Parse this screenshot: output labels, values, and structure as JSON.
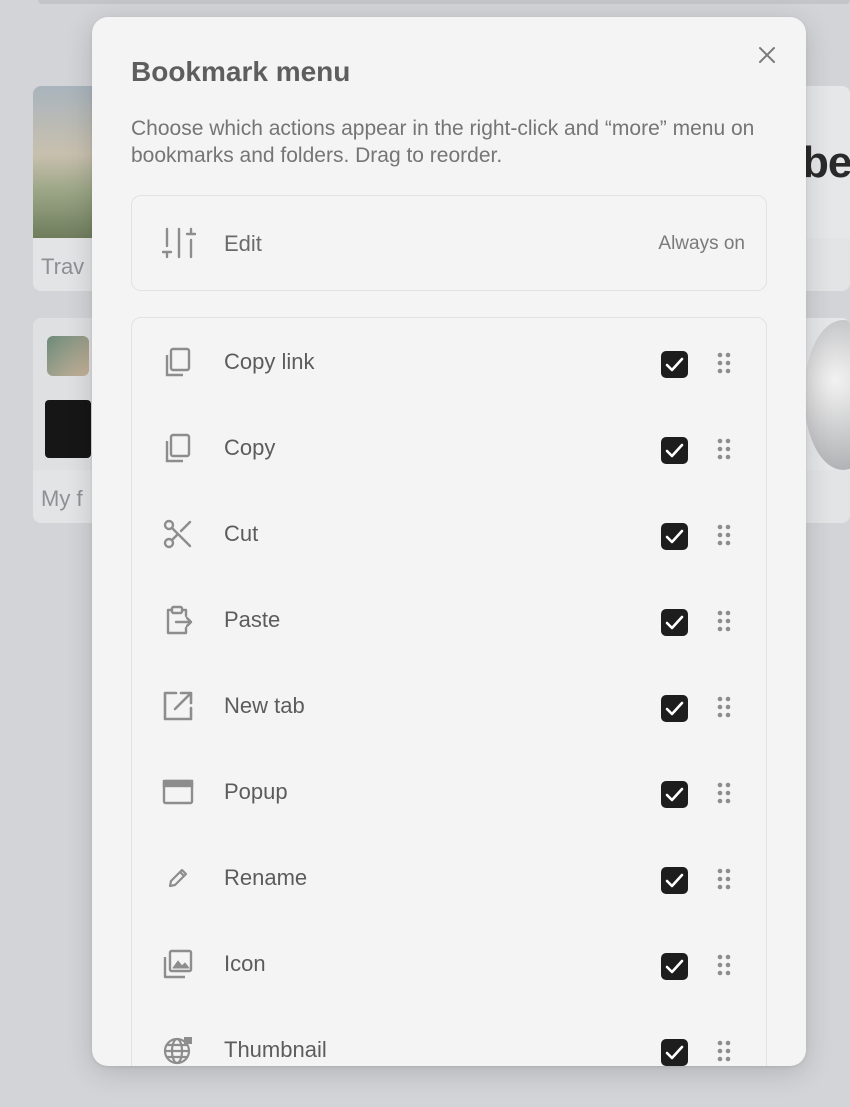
{
  "background": {
    "cards": [
      {
        "label": "Trav"
      },
      {
        "label": "My f"
      },
      {
        "label": "be"
      }
    ]
  },
  "dialog": {
    "title": "Bookmark menu",
    "description": "Choose which actions appear in the right-click and “more” menu on bookmarks and folders. Drag to reorder.",
    "fixed_item": {
      "label": "Edit",
      "state": "Always on"
    },
    "items": [
      {
        "label": "Copy link",
        "icon": "copy-link-icon",
        "checked": true
      },
      {
        "label": "Copy",
        "icon": "copy-icon",
        "checked": true
      },
      {
        "label": "Cut",
        "icon": "scissors-icon",
        "checked": true
      },
      {
        "label": "Paste",
        "icon": "paste-icon",
        "checked": true
      },
      {
        "label": "New tab",
        "icon": "open-in-new-tab-icon",
        "checked": true
      },
      {
        "label": "Popup",
        "icon": "popup-window-icon",
        "checked": true
      },
      {
        "label": "Rename",
        "icon": "pencil-icon",
        "checked": true
      },
      {
        "label": "Icon",
        "icon": "image-stack-icon",
        "checked": true
      },
      {
        "label": "Thumbnail",
        "icon": "globe-icon",
        "checked": true
      }
    ]
  }
}
